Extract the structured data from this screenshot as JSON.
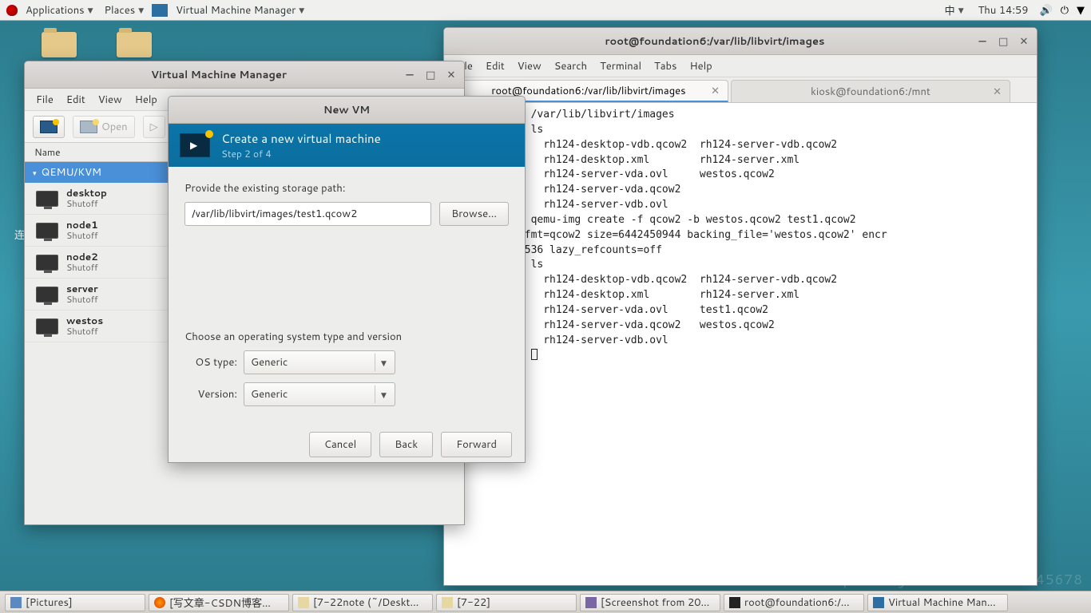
{
  "topbar": {
    "applications": "Applications",
    "places": "Places",
    "appname": "Virtual Machine Manager",
    "ime": "中",
    "clock": "Thu 14:59"
  },
  "desktop_icons": [
    "",
    ""
  ],
  "vmm": {
    "title": "Virtual Machine Manager",
    "menu": {
      "file": "File",
      "edit": "Edit",
      "view": "View",
      "help": "Help"
    },
    "toolbar": {
      "open": "Open"
    },
    "list_header": "Name",
    "host": "QEMU/KVM",
    "vms": [
      {
        "name": "desktop",
        "state": "Shutoff"
      },
      {
        "name": "node1",
        "state": "Shutoff"
      },
      {
        "name": "node2",
        "state": "Shutoff"
      },
      {
        "name": "server",
        "state": "Shutoff"
      },
      {
        "name": "westos",
        "state": "Shutoff"
      }
    ]
  },
  "newvm": {
    "title": "New VM",
    "heading": "Create a new virtual machine",
    "step": "Step 2 of 4",
    "path_label": "Provide the existing storage path:",
    "path_value": "/var/lib/libvirt/images/test1.qcow2",
    "browse": "Browse...",
    "os_heading": "Choose an operating system type and version",
    "os_type_label": "OS type:",
    "os_type_value": "Generic",
    "version_label": "Version:",
    "version_value": "Generic",
    "cancel": "Cancel",
    "back": "Back",
    "forward": "Forward"
  },
  "terminal": {
    "title": "root@foundation6:/var/lib/libvirt/images",
    "menu": {
      "file": "File",
      "edit": "Edit",
      "view": "View",
      "search": "Search",
      "terminal": "Terminal",
      "tabs": "Tabs",
      "help": "Help"
    },
    "tab1": "root@foundation6:/var/lib/libvirt/images",
    "tab2": "kiosk@foundation6:/mnt",
    "body": "ion6 mnt]# cd /var/lib/libvirt/images\nion6 images]# ls\n                rh124-desktop-vdb.qcow2  rh124-server-vdb.qcow2\n                rh124-desktop.xml        rh124-server.xml\n-vda.ovl        rh124-server-vda.ovl     westos.qcow2\n-vda.qcow2      rh124-server-vda.qcow2\n-vdb.ovl        rh124-server-vdb.ovl\nion6 images]# qemu-img create -f qcow2 -b westos.qcow2 test1.qcow2\nest1.qcow2', fmt=qcow2 size=6442450944 backing_file='westos.qcow2' encr\nuster_size=65536 lazy_refcounts=off\nion6 images]# ls\n                rh124-desktop-vdb.qcow2  rh124-server-vdb.qcow2\n                rh124-desktop.xml        rh124-server.xml\n-vda.ovl        rh124-server-vda.ovl     test1.qcow2\n-vda.qcow2      rh124-server-vda.qcow2   westos.qcow2\n-vdb.ovl        rh124-server-vdb.ovl\nion6 images]# "
  },
  "taskbar": {
    "items": [
      "[Pictures]",
      "[写文章-CSDN博客…",
      "[7-22note (~/Deskt…",
      "[7-22]",
      "[Screenshot from 20…",
      "root@foundation6:/…",
      "Virtual Machine Man…"
    ]
  },
  "left_cut": "连"
}
